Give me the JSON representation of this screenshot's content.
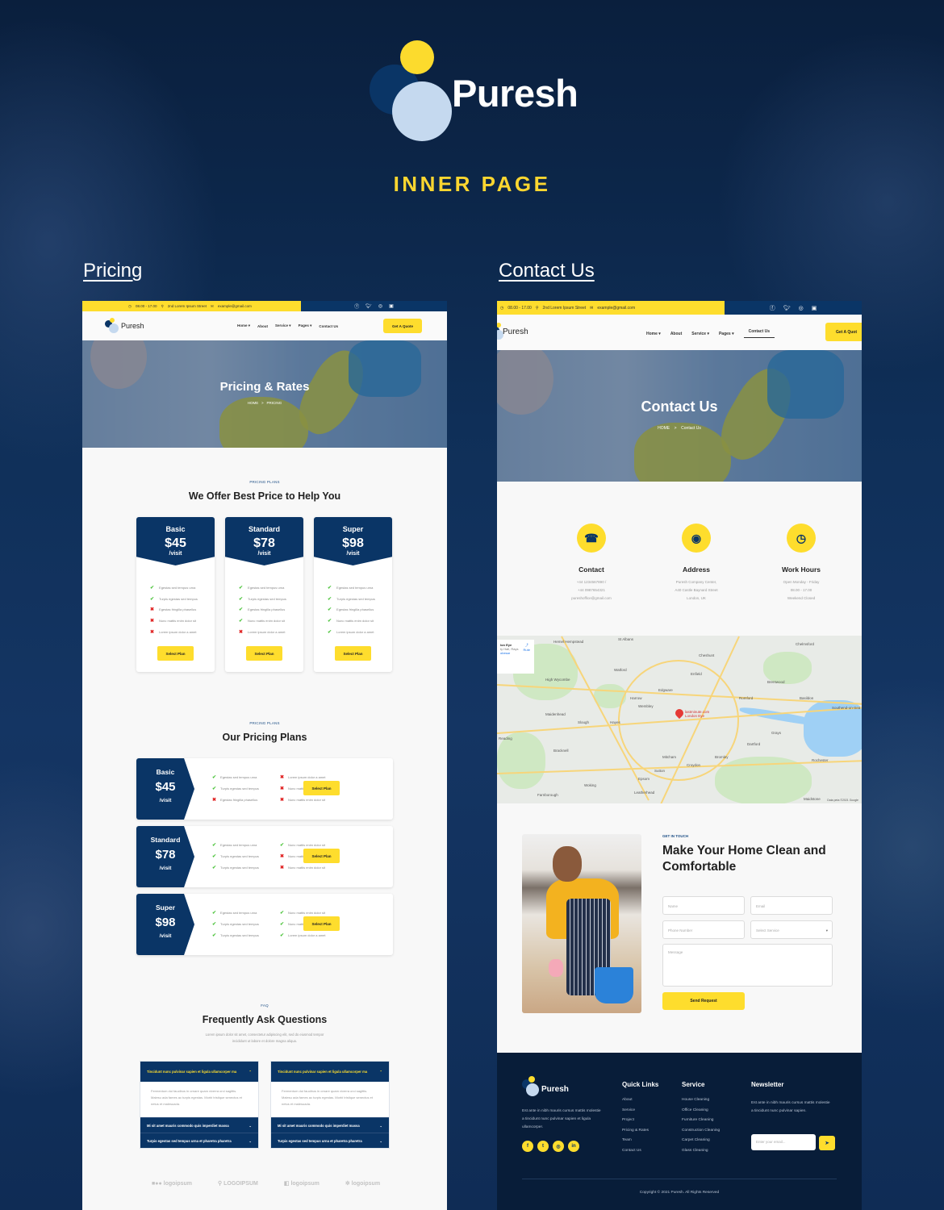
{
  "hero": {
    "brand": "Puresh",
    "subtitle": "INNER PAGE"
  },
  "sections": {
    "pricing_title": "Pricing",
    "contact_title": "Contact Us"
  },
  "topbar": {
    "hours": "08.00 - 17.00",
    "address": "2nd Lorem Ipsum Street",
    "email": "example@gmail.com",
    "social": [
      "facebook",
      "twitter",
      "instagram",
      "linkedin"
    ]
  },
  "nav": {
    "brand": "Puresh",
    "items": [
      "Home",
      "About",
      "Service",
      "Pages",
      "Contact Us"
    ],
    "dropdown_items": [
      "Home",
      "Service",
      "Pages"
    ],
    "active_contact": "Contact Us",
    "quote": "Get A Quote",
    "quote_cut": "Get A Quot"
  },
  "pricing_page": {
    "banner": {
      "title": "Pricing & Rates",
      "crumb_home": "HOME",
      "crumb_sep": ">",
      "crumb_current": "PRICING"
    },
    "section1": {
      "kicker": "PRICING PLANS",
      "title": "We Offer Best Price to Help You"
    },
    "cards": [
      {
        "name": "Basic",
        "price": "$45",
        "unit": "/visit",
        "button": "Select Plan",
        "features": [
          {
            "t": "Egestas sed tempus urna",
            "ok": true
          },
          {
            "t": "Turpis egestas sed tempus",
            "ok": true
          },
          {
            "t": "Egestas fringilla phasellus",
            "ok": false
          },
          {
            "t": "Nunc mattis enim dolor sit",
            "ok": false
          },
          {
            "t": "Lorem ipsum dolor a amet",
            "ok": false
          }
        ]
      },
      {
        "name": "Standard",
        "price": "$78",
        "unit": "/visit",
        "button": "Select Plan",
        "features": [
          {
            "t": "Egestas sed tempus urna",
            "ok": true
          },
          {
            "t": "Turpis egestas sed tempus",
            "ok": true
          },
          {
            "t": "Egestas fringilla phasellus",
            "ok": true
          },
          {
            "t": "Nunc mattis enim dolor sit",
            "ok": true
          },
          {
            "t": "Lorem ipsum dolor a amet",
            "ok": false
          }
        ]
      },
      {
        "name": "Super",
        "price": "$98",
        "unit": "/visit",
        "button": "Select Plan",
        "features": [
          {
            "t": "Egestas sed tempus urna",
            "ok": true
          },
          {
            "t": "Turpis egestas sed tempus",
            "ok": true
          },
          {
            "t": "Egestas fringilla phasellus",
            "ok": true
          },
          {
            "t": "Nunc mattis enim dolor sit",
            "ok": true
          },
          {
            "t": "Lorem ipsum dolor a amet",
            "ok": true
          }
        ]
      }
    ],
    "section2": {
      "kicker": "PRICING PLANS",
      "title": "Our Pricing Plans"
    },
    "rows": [
      {
        "name": "Basic",
        "price": "$45",
        "unit": "/visit",
        "button": "Select Plan",
        "left": [
          {
            "t": "Egestas sed tempus urna",
            "ok": true
          },
          {
            "t": "Turpis egestas sed tempus",
            "ok": true
          },
          {
            "t": "Egestas fringilla phasellus",
            "ok": false
          }
        ],
        "right": [
          {
            "t": "Lorem ipsum dolor a amet",
            "ok": false
          },
          {
            "t": "Nunc mattis enim dolor sit",
            "ok": false
          },
          {
            "t": "Nunc mattis enim dolor sit",
            "ok": false
          }
        ]
      },
      {
        "name": "Standard",
        "price": "$78",
        "unit": "/visit",
        "button": "Select Plan",
        "left": [
          {
            "t": "Egestas sed tempus urna",
            "ok": true
          },
          {
            "t": "Turpis egestas sed tempus",
            "ok": true
          },
          {
            "t": "Turpis egestas sed tempus",
            "ok": true
          }
        ],
        "right": [
          {
            "t": "Nunc mattis enim dolor sit",
            "ok": true
          },
          {
            "t": "Nunc mattis enim dolor sit",
            "ok": false
          },
          {
            "t": "Nunc mattis enim dolor sit",
            "ok": false
          }
        ]
      },
      {
        "name": "Super",
        "price": "$98",
        "unit": "/visit",
        "button": "Select Plan",
        "left": [
          {
            "t": "Egestas sed tempus urna",
            "ok": true
          },
          {
            "t": "Turpis egestas sed tempus",
            "ok": true
          },
          {
            "t": "Turpis egestas sed tempus",
            "ok": true
          }
        ],
        "right": [
          {
            "t": "Nunc mattis enim dolor sit",
            "ok": true
          },
          {
            "t": "Nunc mattis enim dolor sit",
            "ok": true
          },
          {
            "t": "Lorem ipsum dolor a amet",
            "ok": true
          }
        ]
      }
    ],
    "faq": {
      "kicker": "FAQ",
      "title": "Frequently Ask Questions",
      "intro": "Lorem ipsum dolor sit amet, consectetur adipiscing elit, sed do eiusmod tempor incididunt ut labore et dolore magna aliqua.",
      "columns": [
        {
          "open_q": "Tincidunt nunc pulvinar sapien et ligula ullamcorper ma",
          "open_a": "Fermentum dui faucibus in ornare quam viverra orci sagittis. Malesu ada fames ac turpis egestas. Morbi tristique senectus et netus et malesuada.",
          "closed": [
            "Mi sit amet mauris commodo quis imperdiet massa",
            "Turpis egestas sed tempus urna et pharetra pharetra"
          ]
        },
        {
          "open_q": "Tincidunt nunc pulvinar sapien et ligula ullamcorper ma",
          "open_a": "Fermentum dui faucibus in ornare quam viverra orci sagittis. Malesu ada fames ac turpis egestas. Morbi tristique senectus et netus et malesuada.",
          "closed": [
            "Mi sit amet mauris commodo quis imperdiet massa",
            "Turpis egestas sed tempus urna et pharetra pharetra"
          ]
        }
      ]
    },
    "partner_logos": [
      "logoipsum",
      "LOGOIPSUM",
      "logoipsum",
      "logoipsum"
    ]
  },
  "contact_page": {
    "banner": {
      "title": "Contact Us",
      "crumb_home": "HOME",
      "crumb_sep": ">",
      "crumb_current": "Contact Us"
    },
    "info": [
      {
        "icon": "phone-icon",
        "glyph": "☎",
        "title": "Contact",
        "lines": [
          "+44 1234567890 /",
          "+44 0987654321",
          "pureshoffice@gmail.com"
        ]
      },
      {
        "icon": "location-pin-icon",
        "glyph": "◉",
        "title": "Address",
        "lines": [
          "Puresh Company Center,",
          "A40 Castle Baynard Street",
          "London, UK"
        ]
      },
      {
        "icon": "clock-icon",
        "glyph": "◷",
        "title": "Work Hours",
        "lines": [
          "Open Monday - Friday",
          "08.00 - 17.00",
          "Weekend Closed"
        ]
      }
    ],
    "map": {
      "place_card_title": "lon Eye",
      "place_card_sub": "ty Hall, Rays",
      "place_card_link": "obesar",
      "directions": "Rute",
      "pin_label": "lastminute.com London Eye",
      "labels": [
        "Hemel Hempstead",
        "St Albans",
        "Chelmsford",
        "Watford",
        "Cheshunt",
        "Enfield",
        "High Wycombe",
        "Edgware",
        "Harrow",
        "Brentwood",
        "Wembley",
        "Romford",
        "Basildon",
        "Maidenhead",
        "Slough",
        "Hayes",
        "Southend-on-Sea",
        "Reading",
        "Bracknell",
        "Mitcham",
        "Croydon",
        "Bromley",
        "Dartford",
        "Grays",
        "Epsom",
        "Sutton",
        "Woking",
        "Leatherhead",
        "Farnborough",
        "Maidstone",
        "Rochester"
      ],
      "attribution": "Data peta ©2021 Google"
    },
    "form": {
      "kicker": "GET IN TOUCH",
      "title": "Make Your Home Clean and Comfortable",
      "name_ph": "Name",
      "email_ph": "Email",
      "phone_ph": "Phone Number",
      "service_ph": "Select Service",
      "message_ph": "Message",
      "submit": "Send Request"
    },
    "footer": {
      "brand": "Puresh",
      "about": "Est ante in nibh mauris cursus mattis molestie a tincidunt nunc pulvinar sapien et ligula ullamcorper.",
      "quick_title": "Quick Links",
      "quick": [
        "About",
        "Service",
        "Project",
        "Pricing & Rates",
        "Team",
        "Contact Us"
      ],
      "service_title": "Service",
      "services": [
        "House Cleaning",
        "Office Cleaning",
        "Furniture Cleaning",
        "Construction Cleaning",
        "Carpet Cleaning",
        "Glass Cleaning"
      ],
      "news_title": "Newsletter",
      "news_text": "Est ante in nibh mauris cursus mattis molestie a tincidunt nunc pulvinar sapien.",
      "email_ph": "Enter your email...",
      "copyright": "Copyright © 2021 Puresh. All Rights Reserved"
    }
  },
  "colors": {
    "navy": "#0a3566",
    "yellow": "#fedd2d",
    "light_blue": "#c5d9ef",
    "dark_bg": "#081d39"
  }
}
